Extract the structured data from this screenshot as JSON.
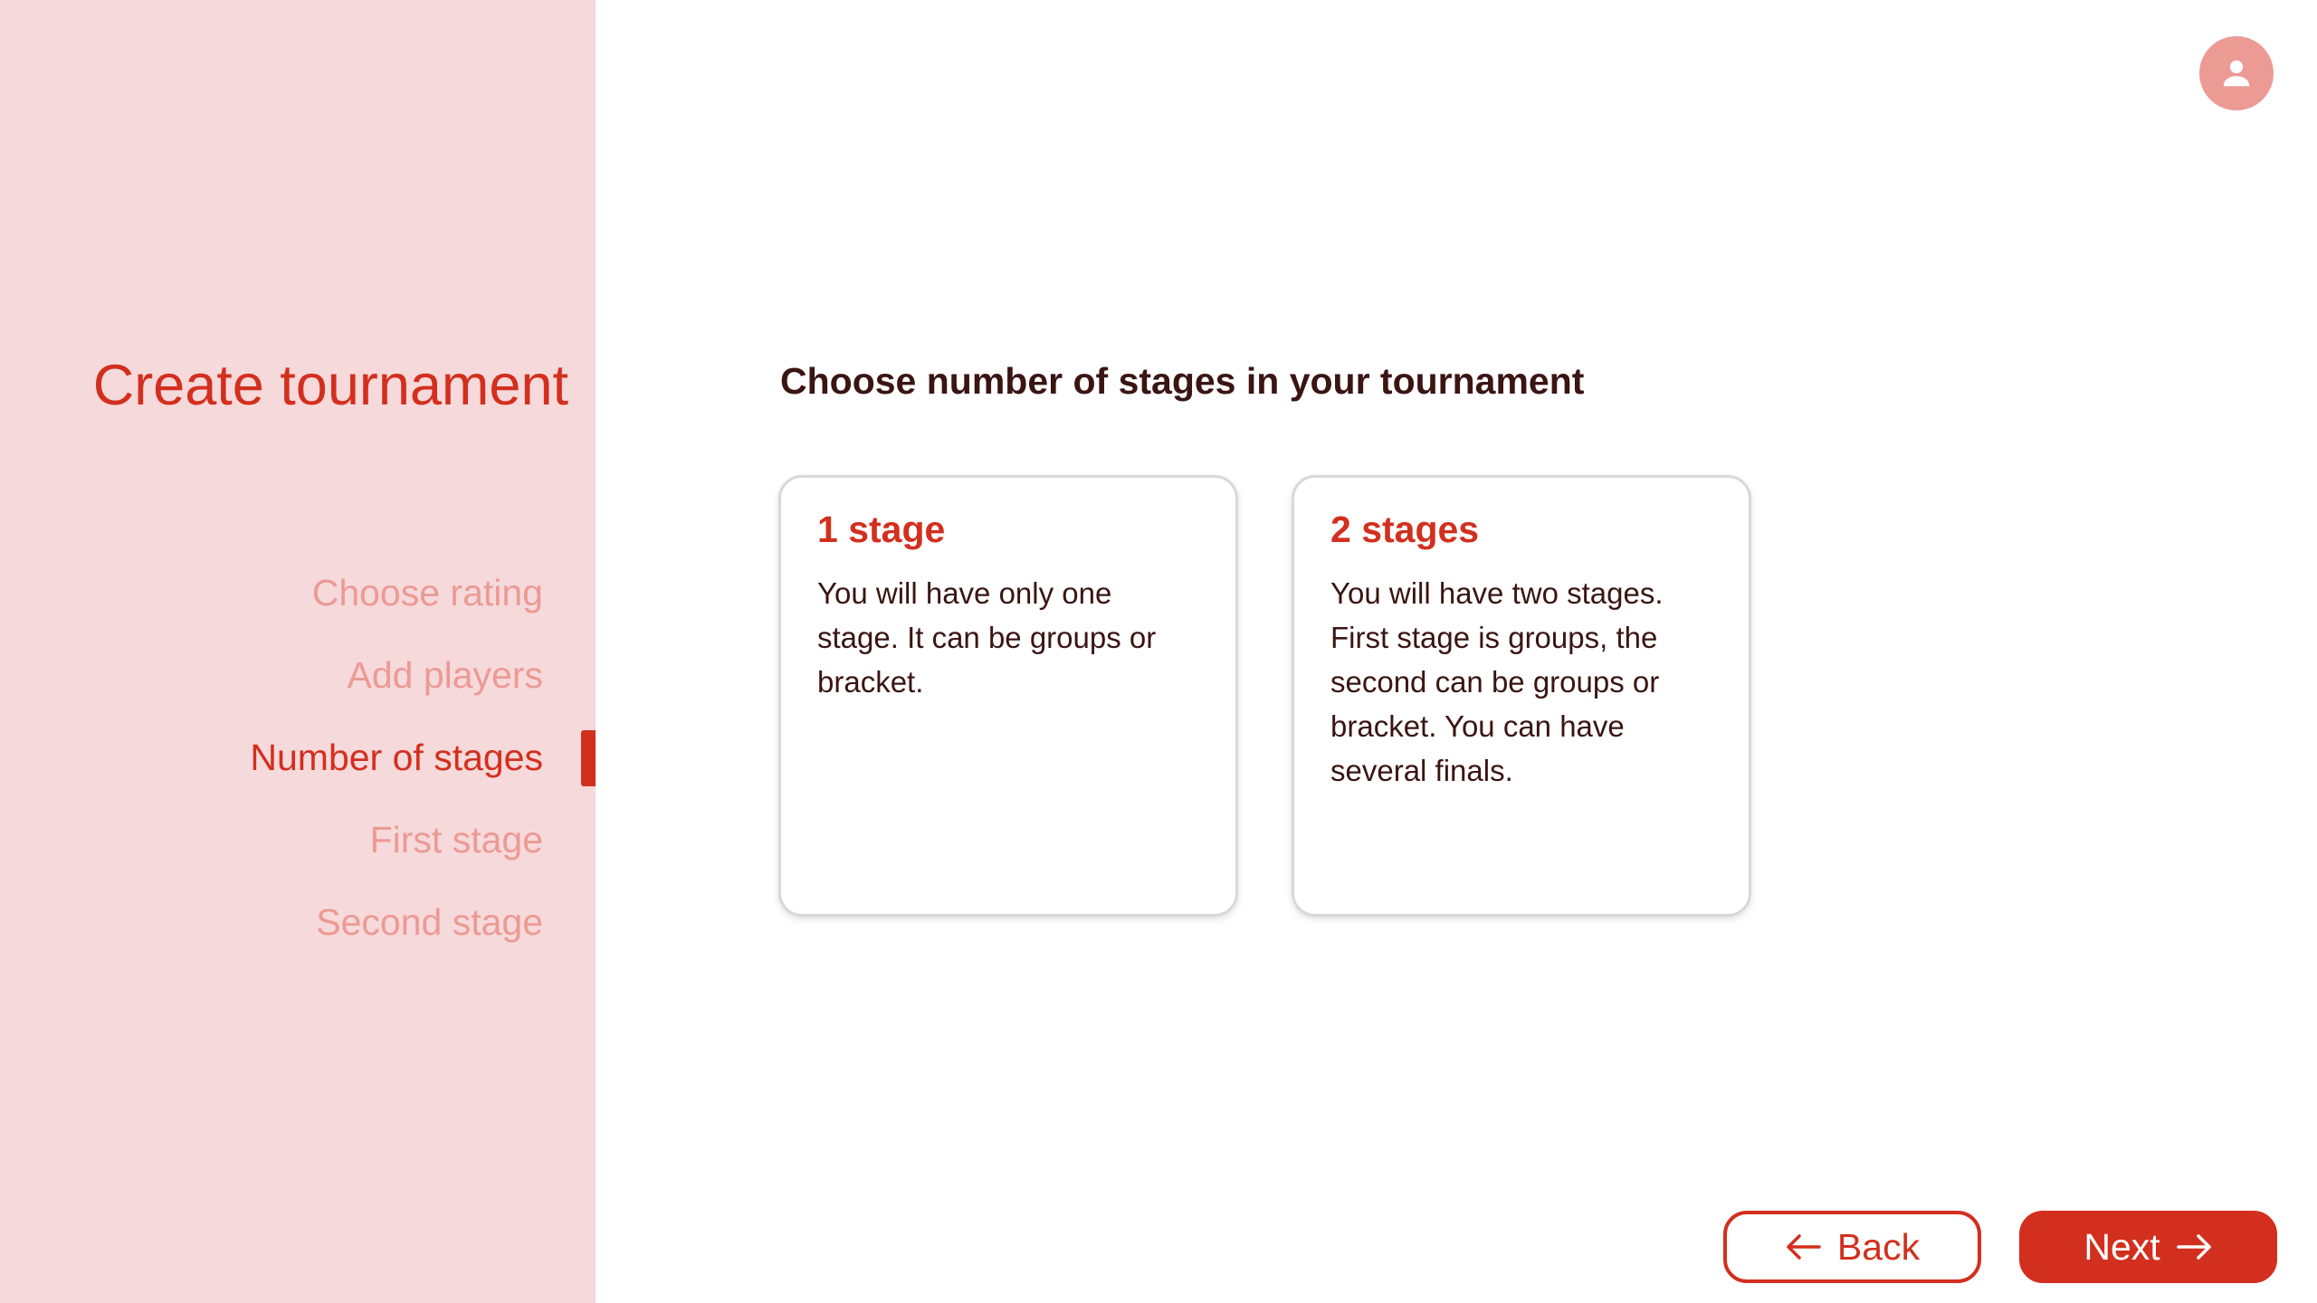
{
  "sidebar": {
    "title": "Create tournament",
    "steps": [
      {
        "label": "Choose rating",
        "active": false
      },
      {
        "label": "Add players",
        "active": false
      },
      {
        "label": "Number of stages",
        "active": true
      },
      {
        "label": "First stage",
        "active": false
      },
      {
        "label": "Second stage",
        "active": false
      }
    ]
  },
  "header": {
    "avatar_icon": "user-icon"
  },
  "main": {
    "heading": "Choose number of stages in your tournament",
    "options": [
      {
        "title": "1 stage",
        "description": "You will have only one stage. It can be groups or bracket."
      },
      {
        "title": "2 stages",
        "description": "You will have two stages. First stage is groups, the second can be groups or bracket. You can have several finals."
      }
    ]
  },
  "footer": {
    "back_label": "Back",
    "next_label": "Next",
    "back_icon": "arrow-left-icon",
    "next_icon": "arrow-right-icon"
  },
  "colors": {
    "accent": "#d32f1e",
    "sidebar_bg": "#f6d9da",
    "muted": "#ec9a94",
    "text_dark": "#3a1512"
  }
}
